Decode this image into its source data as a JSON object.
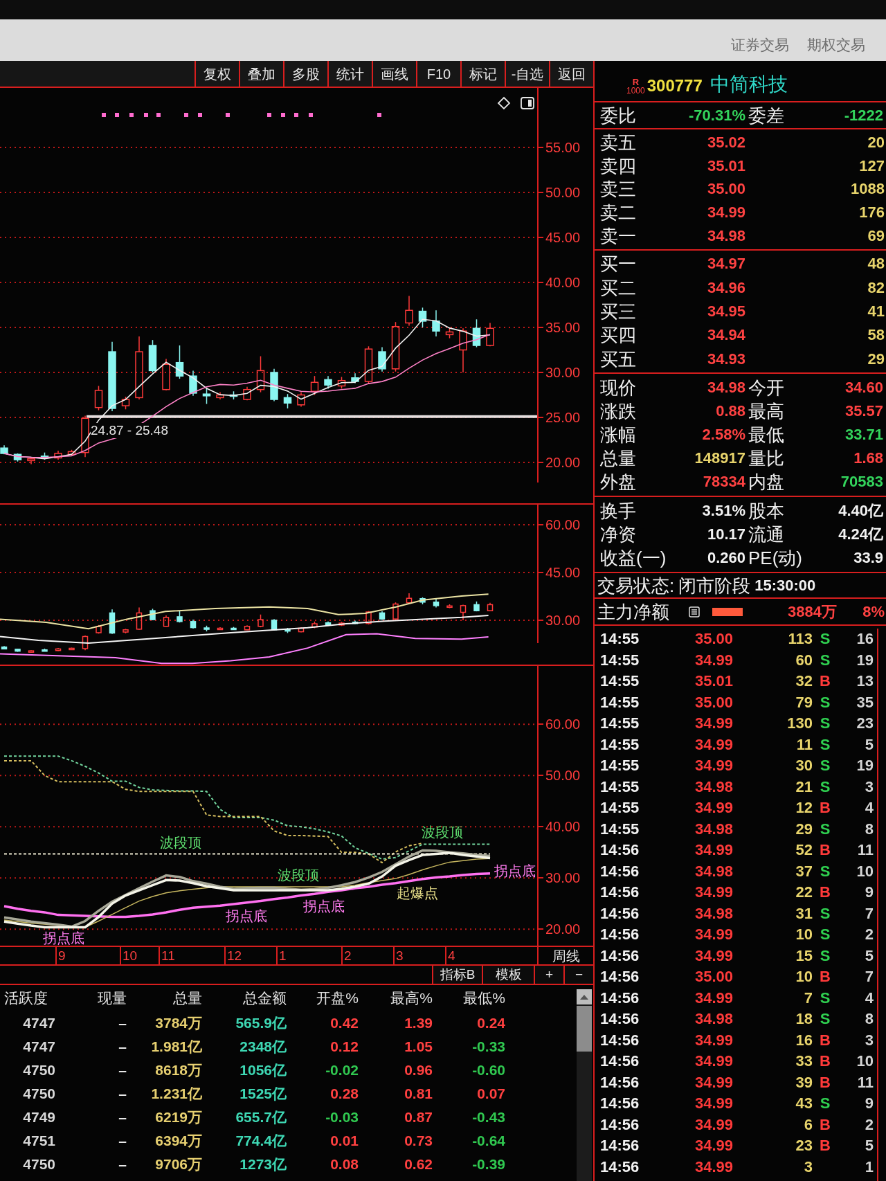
{
  "top_bar": {
    "tabs": [
      "证券交易",
      "期权交易"
    ]
  },
  "toolbar": {
    "buttons": [
      "复权",
      "叠加",
      "多股",
      "统计",
      "画线",
      "F10",
      "标记",
      "-自选",
      "返回"
    ]
  },
  "price_chart": {
    "y_labels": [
      "55.00",
      "50.00",
      "45.00",
      "40.00",
      "35.00",
      "30.00",
      "25.00",
      "20.00"
    ],
    "range_label": "24.87 - 25.48"
  },
  "band_chart": {
    "y_labels": [
      "60.00",
      "45.00",
      "30.00"
    ]
  },
  "signal_chart": {
    "chart_data": {
      "type": "line",
      "grid": true,
      "categories": [
        null,
        null,
        null,
        null,
        null,
        null,
        null,
        null,
        null,
        null,
        null,
        null,
        null,
        null,
        null,
        null,
        null,
        null,
        null,
        null,
        null,
        null,
        null,
        null,
        null,
        null,
        null,
        null,
        null,
        null,
        null,
        null,
        null,
        null,
        null,
        null,
        null
      ],
      "ylim": [
        16.8,
        71.4
      ],
      "yticks": [
        {
          "value": 60,
          "label": "60.00"
        },
        {
          "value": 50,
          "label": "50.00"
        },
        {
          "value": 40,
          "label": "40.00"
        },
        {
          "value": 30,
          "label": "30.00"
        },
        {
          "value": 20,
          "label": "20.00"
        }
      ],
      "series": [
        {
          "color": "#74d8a0",
          "line_style": "dashed",
          "values": [
            53.8,
            53.8,
            53.8,
            53.8,
            53.8,
            52.9,
            51.8,
            50.5,
            48.9,
            48.9,
            47.7,
            47.2,
            47.1,
            47.0,
            47.0,
            46.9,
            43.4,
            41.8,
            41.8,
            41.8,
            41.3,
            40.2,
            40.0,
            39.6,
            39.0,
            38.2,
            35.9,
            34.8,
            33.7,
            34.0,
            35.3,
            36.6,
            36.6,
            36.6,
            36.6,
            36.6,
            36.6
          ]
        },
        {
          "color": "#d8c060",
          "line_style": "dashed",
          "values": [
            52.9,
            52.9,
            52.9,
            50.0,
            48.8,
            48.8,
            48.8,
            48.8,
            48.8,
            47.3,
            46.9,
            46.9,
            46.9,
            46.9,
            46.9,
            42.3,
            42.0,
            42.0,
            42.0,
            42.0,
            39.2,
            38.3,
            38.3,
            38.2,
            38.1,
            35.0,
            35.0,
            34.7,
            33.0,
            35.1,
            36.3,
            36.8,
            null,
            null,
            null,
            null,
            null
          ]
        },
        {
          "color": "#ece8d0",
          "line_style": "dashed",
          "values": [
            34.7,
            34.7,
            34.7,
            34.7,
            34.7,
            34.7,
            34.7,
            34.7,
            34.7,
            34.7,
            34.7,
            34.7,
            34.7,
            34.7,
            34.7,
            34.7,
            34.7,
            34.7,
            34.7,
            34.7,
            34.7,
            34.7,
            34.7,
            34.7,
            34.7,
            34.7,
            34.7,
            34.7,
            34.7,
            34.7,
            34.7,
            34.7,
            34.7,
            34.7,
            34.7,
            34.7,
            34.7
          ]
        },
        {
          "color": "#ff70f0",
          "line_style": "solid",
          "values": [
            24.5,
            24.0,
            23.6,
            23.3,
            22.8,
            22.7,
            22.6,
            22.5,
            22.4,
            22.4,
            22.6,
            22.9,
            23.3,
            23.8,
            24.2,
            24.4,
            24.6,
            24.9,
            25.2,
            25.5,
            25.9,
            26.2,
            26.6,
            26.9,
            27.3,
            27.6,
            28.0,
            28.3,
            28.7,
            29.0,
            29.4,
            29.8,
            30.1,
            30.3,
            30.6,
            30.8,
            30.9
          ]
        },
        {
          "color": "#c8b860",
          "line_style": "solid",
          "values": [
            21.8,
            21.5,
            21.2,
            21.0,
            20.7,
            20.5,
            20.4,
            21.6,
            22.9,
            24.2,
            25.5,
            26.4,
            27.1,
            27.5,
            27.8,
            28.1,
            28.3,
            28.3,
            28.3,
            28.3,
            28.3,
            28.3,
            28.3,
            28.3,
            28.3,
            28.3,
            28.6,
            29.1,
            29.5,
            29.9,
            30.7,
            31.6,
            32.4,
            33.1,
            33.4,
            33.7,
            33.8
          ]
        },
        {
          "color": "#a8a898",
          "line_style": "solid",
          "values": [
            22.3,
            21.9,
            21.5,
            21.2,
            20.9,
            20.5,
            21.6,
            23.6,
            25.4,
            26.7,
            28.0,
            29.3,
            30.5,
            30.2,
            29.4,
            28.9,
            28.3,
            27.9,
            28.0,
            28.1,
            28.1,
            27.9,
            27.7,
            27.8,
            28.1,
            28.6,
            29.2,
            30.1,
            31.2,
            32.7,
            34.2,
            35.4,
            35.3,
            35.0,
            34.8,
            34.5,
            34.3
          ]
        },
        {
          "color": "#f4f4e8",
          "line_style": "solid",
          "values": [
            21.5,
            21.1,
            20.7,
            20.4,
            20.4,
            20.4,
            20.4,
            22.4,
            25.0,
            26.6,
            27.6,
            28.6,
            29.6,
            29.5,
            29.0,
            28.4,
            28.0,
            27.6,
            27.6,
            27.6,
            27.6,
            27.6,
            27.6,
            27.6,
            27.6,
            27.9,
            28.3,
            28.9,
            30.3,
            32.4,
            33.5,
            34.5,
            34.7,
            34.9,
            34.5,
            34.2,
            33.9
          ]
        }
      ]
    },
    "annotations": [
      {
        "text": "拐点底",
        "kind": "turn_bottom"
      },
      {
        "text": "波段顶",
        "kind": "wave_top"
      },
      {
        "text": "拐点底",
        "kind": "turn_bottom"
      },
      {
        "text": "波段顶",
        "kind": "wave_top"
      },
      {
        "text": "拐点底",
        "kind": "turn_bottom"
      },
      {
        "text": "起爆点",
        "kind": "breakout"
      },
      {
        "text": "波段顶",
        "kind": "wave_top"
      },
      {
        "text": "拐点底",
        "kind": "turn_bottom"
      }
    ]
  },
  "time_axis": {
    "labels": [
      "9",
      "10",
      "11",
      "12",
      "1",
      "2",
      "3",
      "4"
    ],
    "period": "周线"
  },
  "indicator_bar": {
    "buttons": [
      "指标B",
      "模板",
      "+",
      "−"
    ]
  },
  "table": {
    "columns": [
      "活跃度",
      "现量",
      "总量",
      "总金额",
      "开盘%",
      "最高%",
      "最低%"
    ],
    "rows": [
      {
        "activity": "4747",
        "current_volume": "–",
        "total_volume": "3784万",
        "total_amount": "565.9亿",
        "open_pct": {
          "value": "0.42",
          "up": true
        },
        "high_pct": {
          "value": "1.39",
          "up": true
        },
        "low_pct": {
          "value": "0.24",
          "up": true
        }
      },
      {
        "activity": "4747",
        "current_volume": "–",
        "total_volume": "1.981亿",
        "total_amount": "2348亿",
        "open_pct": {
          "value": "0.12",
          "up": true
        },
        "high_pct": {
          "value": "1.05",
          "up": true
        },
        "low_pct": {
          "value": "-0.33",
          "up": false
        }
      },
      {
        "activity": "4750",
        "current_volume": "–",
        "total_volume": "8618万",
        "total_amount": "1056亿",
        "open_pct": {
          "value": "-0.02",
          "up": false
        },
        "high_pct": {
          "value": "0.96",
          "up": true
        },
        "low_pct": {
          "value": "-0.60",
          "up": false
        }
      },
      {
        "activity": "4750",
        "current_volume": "–",
        "total_volume": "1.231亿",
        "total_amount": "1525亿",
        "open_pct": {
          "value": "0.28",
          "up": true
        },
        "high_pct": {
          "value": "0.81",
          "up": true
        },
        "low_pct": {
          "value": "0.07",
          "up": true
        }
      },
      {
        "activity": "4749",
        "current_volume": "–",
        "total_volume": "6219万",
        "total_amount": "655.7亿",
        "open_pct": {
          "value": "-0.03",
          "up": false
        },
        "high_pct": {
          "value": "0.87",
          "up": true
        },
        "low_pct": {
          "value": "-0.43",
          "up": false
        }
      },
      {
        "activity": "4751",
        "current_volume": "–",
        "total_volume": "6394万",
        "total_amount": "774.4亿",
        "open_pct": {
          "value": "0.01",
          "up": true
        },
        "high_pct": {
          "value": "0.73",
          "up": true
        },
        "low_pct": {
          "value": "-0.64",
          "up": false
        }
      },
      {
        "activity": "4750",
        "current_volume": "–",
        "total_volume": "9706万",
        "total_amount": "1273亿",
        "open_pct": {
          "value": "0.08",
          "up": true
        },
        "high_pct": {
          "value": "0.62",
          "up": true
        },
        "low_pct": {
          "value": "-0.39",
          "up": false
        }
      }
    ]
  },
  "quote": {
    "stock": {
      "flag_letter": "R",
      "flag_number": "1000",
      "code": "300777",
      "name": "中简科技"
    },
    "ratio": [
      {
        "label": "委比",
        "value": "-70.31%",
        "color": "#33d45c"
      },
      {
        "label": "委差",
        "value": "-1222",
        "color": "#33d45c"
      }
    ],
    "asks": [
      {
        "label": "卖五",
        "price": "35.02",
        "volume": "20"
      },
      {
        "label": "卖四",
        "price": "35.01",
        "volume": "127"
      },
      {
        "label": "卖三",
        "price": "35.00",
        "volume": "1088"
      },
      {
        "label": "卖二",
        "price": "34.99",
        "volume": "176"
      },
      {
        "label": "卖一",
        "price": "34.98",
        "volume": "69"
      }
    ],
    "bids": [
      {
        "label": "买一",
        "price": "34.97",
        "volume": "48"
      },
      {
        "label": "买二",
        "price": "34.96",
        "volume": "82"
      },
      {
        "label": "买三",
        "price": "34.95",
        "volume": "41"
      },
      {
        "label": "买四",
        "price": "34.94",
        "volume": "58"
      },
      {
        "label": "买五",
        "price": "34.93",
        "volume": "29"
      }
    ],
    "stats": [
      [
        {
          "label": "现价",
          "value": "34.98",
          "color": "#ff4242"
        },
        {
          "label": "今开",
          "value": "34.60",
          "color": "#ff4242"
        }
      ],
      [
        {
          "label": "涨跌",
          "value": "0.88",
          "color": "#ff4242"
        },
        {
          "label": "最高",
          "value": "35.57",
          "color": "#ff4242"
        }
      ],
      [
        {
          "label": "涨幅",
          "value": "2.58%",
          "color": "#ff4242"
        },
        {
          "label": "最低",
          "value": "33.71",
          "color": "#33d45c"
        }
      ],
      [
        {
          "label": "总量",
          "value": "148917",
          "color": "#e8d46c"
        },
        {
          "label": "量比",
          "value": "1.68",
          "color": "#ff4242"
        }
      ],
      [
        {
          "label": "外盘",
          "value": "78334",
          "color": "#ff4242"
        },
        {
          "label": "内盘",
          "value": "70583",
          "color": "#33d45c"
        }
      ]
    ],
    "fundamentals": [
      [
        {
          "label": "换手",
          "value": "3.51%",
          "color": "#f2f2f2"
        },
        {
          "label": "股本",
          "value": "4.40亿",
          "color": "#f2f2f2"
        }
      ],
      [
        {
          "label": "净资",
          "value": "10.17",
          "color": "#f2f2f2"
        },
        {
          "label": "流通",
          "value": "4.24亿",
          "color": "#f2f2f2"
        }
      ],
      [
        {
          "label": "收益(一)",
          "value": "0.260",
          "color": "#f2f2f2"
        },
        {
          "label": "PE(动)",
          "value": "33.9",
          "color": "#f2f2f2"
        }
      ]
    ],
    "trading_status": {
      "label": "交易状态:",
      "value": "闭市阶段",
      "time": "15:30:00"
    },
    "main_net": {
      "label": "主力净额",
      "amount": "3884万",
      "percent": "8%"
    },
    "ticks": [
      {
        "time": "14:55",
        "price": "35.00",
        "volume": "113",
        "side": "S",
        "buy": false,
        "count": "16"
      },
      {
        "time": "14:55",
        "price": "34.99",
        "volume": "60",
        "side": "S",
        "buy": false,
        "count": "19"
      },
      {
        "time": "14:55",
        "price": "35.01",
        "volume": "32",
        "side": "B",
        "buy": true,
        "count": "13"
      },
      {
        "time": "14:55",
        "price": "35.00",
        "volume": "79",
        "side": "S",
        "buy": false,
        "count": "35"
      },
      {
        "time": "14:55",
        "price": "34.99",
        "volume": "130",
        "side": "S",
        "buy": false,
        "count": "23"
      },
      {
        "time": "14:55",
        "price": "34.99",
        "volume": "11",
        "side": "S",
        "buy": false,
        "count": "5"
      },
      {
        "time": "14:55",
        "price": "34.99",
        "volume": "30",
        "side": "S",
        "buy": false,
        "count": "19"
      },
      {
        "time": "14:55",
        "price": "34.98",
        "volume": "21",
        "side": "S",
        "buy": false,
        "count": "3"
      },
      {
        "time": "14:55",
        "price": "34.99",
        "volume": "12",
        "side": "B",
        "buy": true,
        "count": "4"
      },
      {
        "time": "14:55",
        "price": "34.98",
        "volume": "29",
        "side": "S",
        "buy": false,
        "count": "8"
      },
      {
        "time": "14:56",
        "price": "34.99",
        "volume": "52",
        "side": "B",
        "buy": true,
        "count": "11"
      },
      {
        "time": "14:56",
        "price": "34.98",
        "volume": "37",
        "side": "S",
        "buy": false,
        "count": "10"
      },
      {
        "time": "14:56",
        "price": "34.99",
        "volume": "22",
        "side": "B",
        "buy": true,
        "count": "9"
      },
      {
        "time": "14:56",
        "price": "34.98",
        "volume": "31",
        "side": "S",
        "buy": false,
        "count": "7"
      },
      {
        "time": "14:56",
        "price": "34.99",
        "volume": "10",
        "side": "S",
        "buy": false,
        "count": "2"
      },
      {
        "time": "14:56",
        "price": "34.99",
        "volume": "15",
        "side": "S",
        "buy": false,
        "count": "5"
      },
      {
        "time": "14:56",
        "price": "35.00",
        "volume": "10",
        "side": "B",
        "buy": true,
        "count": "7"
      },
      {
        "time": "14:56",
        "price": "34.99",
        "volume": "7",
        "side": "S",
        "buy": false,
        "count": "4"
      },
      {
        "time": "14:56",
        "price": "34.98",
        "volume": "18",
        "side": "S",
        "buy": false,
        "count": "8"
      },
      {
        "time": "14:56",
        "price": "34.99",
        "volume": "16",
        "side": "B",
        "buy": true,
        "count": "3"
      },
      {
        "time": "14:56",
        "price": "34.99",
        "volume": "33",
        "side": "B",
        "buy": true,
        "count": "10"
      },
      {
        "time": "14:56",
        "price": "34.99",
        "volume": "39",
        "side": "B",
        "buy": true,
        "count": "11"
      },
      {
        "time": "14:56",
        "price": "34.99",
        "volume": "43",
        "side": "S",
        "buy": false,
        "count": "9"
      },
      {
        "time": "14:56",
        "price": "34.99",
        "volume": "6",
        "side": "B",
        "buy": true,
        "count": "2"
      },
      {
        "time": "14:56",
        "price": "34.99",
        "volume": "23",
        "side": "B",
        "buy": true,
        "count": "5"
      },
      {
        "time": "14:56",
        "price": "34.99",
        "volume": "3",
        "count": "1"
      }
    ]
  }
}
